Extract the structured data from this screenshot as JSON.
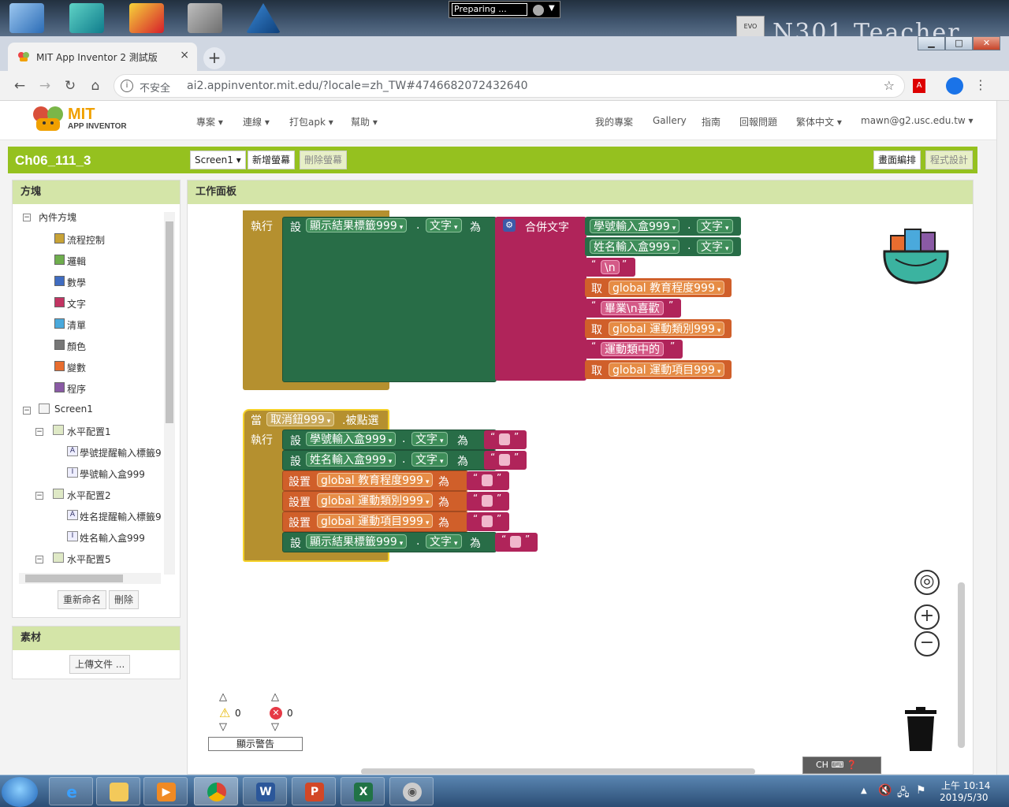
{
  "desktop": {
    "preparing_label": "Preparing ...",
    "title_text": "N301 Teacher",
    "evo_label": "EVO"
  },
  "browser": {
    "tab_title": "MIT App Inventor 2 測試版",
    "tab_close": "×",
    "new_tab": "+",
    "insecure_label": "不安全",
    "url": "ai2.appinventor.mit.edu/?locale=zh_TW#4746682072432640",
    "window_controls": [
      "▁",
      "□",
      "✕"
    ]
  },
  "app": {
    "logo_mit": "MIT",
    "logo_sub": "APP INVENTOR",
    "menus": [
      "專案 ▾",
      "連線 ▾",
      "打包apk ▾",
      "幫助 ▾"
    ],
    "right_menus": [
      "我的專案",
      "Gallery",
      "指南",
      "回報問題",
      "繁体中文 ▾",
      "mawn@g2.usc.edu.tw ▾"
    ]
  },
  "project": {
    "name": "Ch06_111_3",
    "screen_select": "Screen1 ▾",
    "add_screen": "新增螢幕",
    "remove_screen": "刪除螢幕",
    "designer": "畫面編排",
    "blocks": "程式設計"
  },
  "blocks_panel": {
    "title": "方塊",
    "builtin": "內件方塊",
    "categories": [
      {
        "label": "流程控制",
        "color": "#c8a336"
      },
      {
        "label": "邏輯",
        "color": "#6fae4d"
      },
      {
        "label": "數學",
        "color": "#3f6cc1"
      },
      {
        "label": "文字",
        "color": "#c23462"
      },
      {
        "label": "清單",
        "color": "#4aa9dc"
      },
      {
        "label": "顏色",
        "color": "#777777"
      },
      {
        "label": "變數",
        "color": "#e86d2f"
      },
      {
        "label": "程序",
        "color": "#8a5aa5"
      }
    ],
    "components": [
      {
        "label": "Screen1",
        "level": 0
      },
      {
        "label": "水平配置1",
        "level": 1
      },
      {
        "label": "學號提醒輸入標籤9",
        "level": 2,
        "icon": "A"
      },
      {
        "label": "學號輸入盒999",
        "level": 2,
        "icon": "I"
      },
      {
        "label": "水平配置2",
        "level": 1
      },
      {
        "label": "姓名提醒輸入標籤9",
        "level": 2,
        "icon": "A"
      },
      {
        "label": "姓名輸入盒999",
        "level": 2,
        "icon": "I"
      },
      {
        "label": "水平配置5",
        "level": 1
      }
    ],
    "rename": "重新命名",
    "delete": "刪除"
  },
  "media_panel": {
    "title": "素材",
    "upload": "上傳文件 ..."
  },
  "workspace": {
    "title": "工作面板",
    "block1": {
      "do": "執行",
      "set": "設",
      "target": "顯示結果標籤999",
      "prop": "文字",
      "to": "為",
      "join": "合併文字",
      "inputs": [
        {
          "type": "getprop",
          "comp": "學號輸入盒999",
          "prop": "文字"
        },
        {
          "type": "getprop",
          "comp": "姓名輸入盒999",
          "prop": "文字"
        },
        {
          "type": "text",
          "value": "\\n"
        },
        {
          "type": "getvar",
          "kw": "取",
          "var": "global 教育程度999"
        },
        {
          "type": "text",
          "value": "畢業\\n喜歡"
        },
        {
          "type": "getvar",
          "kw": "取",
          "var": "global 運動類別999"
        },
        {
          "type": "text",
          "value": "運動類中的"
        },
        {
          "type": "getvar",
          "kw": "取",
          "var": "global 運動項目999"
        }
      ]
    },
    "block2": {
      "when": "當",
      "button": "取消鈕999",
      "event": "被點選",
      "do": "執行",
      "statements": [
        {
          "kw": "設",
          "target": "學號輸入盒999",
          "prop": "文字",
          "to": "為",
          "kind": "comp"
        },
        {
          "kw": "設",
          "target": "姓名輸入盒999",
          "prop": "文字",
          "to": "為",
          "kind": "comp"
        },
        {
          "kw": "設置",
          "target": "global 教育程度999",
          "to": "為",
          "kind": "var"
        },
        {
          "kw": "設置",
          "target": "global 運動類別999",
          "to": "為",
          "kind": "var"
        },
        {
          "kw": "設置",
          "target": "global 運動項目999",
          "to": "為",
          "kind": "var"
        },
        {
          "kw": "設",
          "target": "顯示結果標籤999",
          "prop": "文字",
          "to": "為",
          "kind": "comp"
        }
      ]
    },
    "warnings_count": "0",
    "errors_count": "0",
    "show_warnings": "顯示警告"
  },
  "taskbar": {
    "time": "上午 10:14",
    "date": "2019/5/30",
    "ime": "CH"
  }
}
